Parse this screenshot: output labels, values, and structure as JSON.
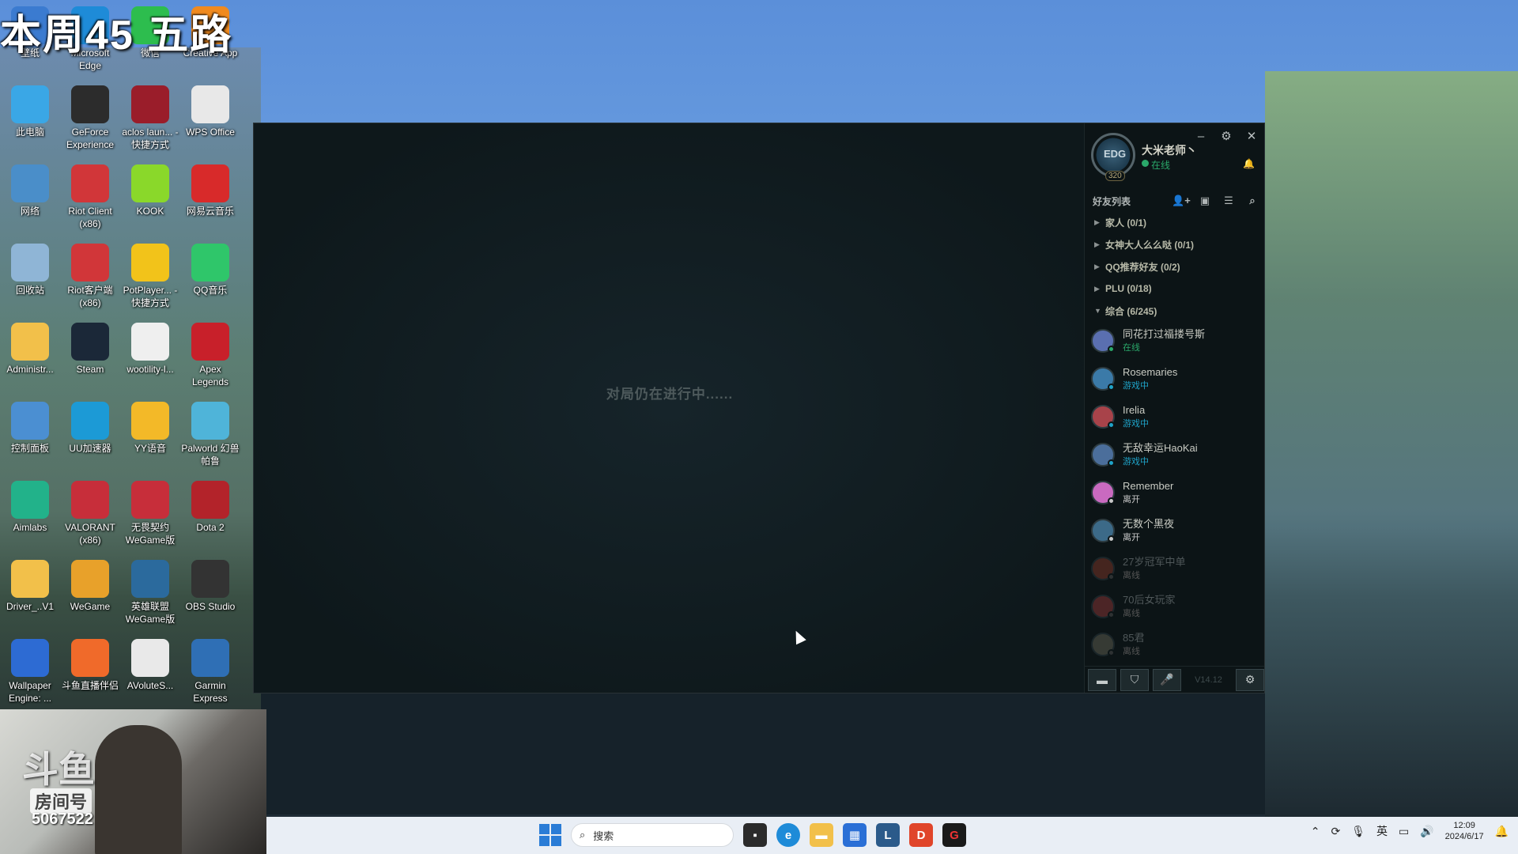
{
  "stream": {
    "title": "本周45 五路",
    "platform_logo": "斗鱼",
    "room_label": "房间号",
    "room_number": "5067522"
  },
  "desktop_icons": [
    {
      "label": "壁纸",
      "icon": "wallpaper-icon",
      "color": "#3b7bd0"
    },
    {
      "label": "Microsoft Edge",
      "icon": "edge-icon",
      "color": "#1e8bd8"
    },
    {
      "label": "微信",
      "icon": "wechat-icon",
      "color": "#2dbd4e"
    },
    {
      "label": "Creative App",
      "icon": "creative-app-icon",
      "color": "#f08a1e"
    },
    {
      "label": "此电脑",
      "icon": "this-pc-icon",
      "color": "#3aa7e6"
    },
    {
      "label": "GeForce Experience",
      "icon": "geforce-icon",
      "color": "#2c2c2c"
    },
    {
      "label": "aclos laun... - 快捷方式",
      "icon": "aclos-icon",
      "color": "#9a1d2a"
    },
    {
      "label": "WPS Office",
      "icon": "wps-icon",
      "color": "#e8e8e8"
    },
    {
      "label": "网络",
      "icon": "network-icon",
      "color": "#4a8ec9"
    },
    {
      "label": "Riot Client (x86)",
      "icon": "riot-client-icon",
      "color": "#d13639"
    },
    {
      "label": "KOOK",
      "icon": "kook-icon",
      "color": "#8ad82a"
    },
    {
      "label": "网易云音乐",
      "icon": "netease-music-icon",
      "color": "#d82a2a"
    },
    {
      "label": "回收站",
      "icon": "recycle-bin-icon",
      "color": "#8fb5d6"
    },
    {
      "label": "Riot客户端 (x86)",
      "icon": "riot-client-icon",
      "color": "#d13639"
    },
    {
      "label": "PotPlayer... - 快捷方式",
      "icon": "potplayer-icon",
      "color": "#f2c31a"
    },
    {
      "label": "QQ音乐",
      "icon": "qq-music-icon",
      "color": "#2fc66a"
    },
    {
      "label": "Administr...",
      "icon": "folder-icon",
      "color": "#f2c04a"
    },
    {
      "label": "Steam",
      "icon": "steam-icon",
      "color": "#1b2838"
    },
    {
      "label": "wootility-l...",
      "icon": "wootility-icon",
      "color": "#efefef"
    },
    {
      "label": "Apex Legends",
      "icon": "apex-icon",
      "color": "#c8202a"
    },
    {
      "label": "控制面板",
      "icon": "control-panel-icon",
      "color": "#4b8fd2"
    },
    {
      "label": "UU加速器",
      "icon": "uu-icon",
      "color": "#1c9ad6"
    },
    {
      "label": "YY语音",
      "icon": "yy-icon",
      "color": "#f3b928"
    },
    {
      "label": "Palworld 幻兽帕鲁",
      "icon": "palworld-icon",
      "color": "#4fb4d9"
    },
    {
      "label": "Aimlabs",
      "icon": "aimlabs-icon",
      "color": "#22b28a"
    },
    {
      "label": "VALORANT (x86)",
      "icon": "valorant-icon",
      "color": "#c72e3a"
    },
    {
      "label": "无畏契约 WeGame版",
      "icon": "valorant-wegame-icon",
      "color": "#c72e3a"
    },
    {
      "label": "Dota 2",
      "icon": "dota2-icon",
      "color": "#b3232a"
    },
    {
      "label": "Driver_..V1",
      "icon": "folder-icon",
      "color": "#f2c04a"
    },
    {
      "label": "WeGame",
      "icon": "wegame-icon",
      "color": "#e8a12a"
    },
    {
      "label": "英雄联盟 WeGame版",
      "icon": "lol-wegame-icon",
      "color": "#2b6a9d"
    },
    {
      "label": "OBS Studio",
      "icon": "obs-icon",
      "color": "#333333"
    },
    {
      "label": "Wallpaper Engine: ...",
      "icon": "wallpaper-engine-icon",
      "color": "#2d6bd3"
    },
    {
      "label": "斗鱼直播伴侣",
      "icon": "douyu-companion-icon",
      "color": "#f06a2a"
    },
    {
      "label": "AVoluteS...",
      "icon": "settings-file-icon",
      "color": "#e9e9e9"
    },
    {
      "label": "Garmin Express",
      "icon": "garmin-icon",
      "color": "#2f6fb5"
    }
  ],
  "client": {
    "game_status": "对局仍在进行中......",
    "profile": {
      "name": "大米老师丶",
      "status": "在线",
      "level": "320"
    },
    "friends_list_title": "好友列表",
    "groups": [
      {
        "label": "家人 (0/1)",
        "expanded": false
      },
      {
        "label": "女神大人么么哒 (0/1)",
        "expanded": false
      },
      {
        "label": "QQ推荐好友 (0/2)",
        "expanded": false
      },
      {
        "label": "PLU (0/18)",
        "expanded": false
      },
      {
        "label": "综合 (6/245)",
        "expanded": true
      }
    ],
    "friends": [
      {
        "name": "同花打过福搂号斯",
        "state": "在线",
        "state_color": "#2aa86a",
        "avatar_color": "#5a6fb0",
        "offline": false
      },
      {
        "name": "Rosemaries",
        "state": "游戏中",
        "state_color": "#1fa3c8",
        "avatar_color": "#3b7aa8",
        "offline": false
      },
      {
        "name": "Irelia",
        "state": "游戏中",
        "state_color": "#1fa3c8",
        "avatar_color": "#a8434a",
        "offline": false
      },
      {
        "name": "无敌幸运HaoKai",
        "state": "游戏中",
        "state_color": "#1fa3c8",
        "avatar_color": "#4b6e9b",
        "offline": false
      },
      {
        "name": "Remember",
        "state": "离开",
        "state_color": "#c8c8c8",
        "avatar_color": "#c96ac0",
        "offline": false
      },
      {
        "name": "无数个黑夜",
        "state": "离开",
        "state_color": "#c8c8c8",
        "avatar_color": "#3c6a88",
        "offline": false
      },
      {
        "name": "27岁冠军中单",
        "state": "离线",
        "state_color": "#555555",
        "avatar_color": "#8a3a2a",
        "offline": true
      },
      {
        "name": "70后女玩家",
        "state": "离线",
        "state_color": "#555555",
        "avatar_color": "#9a3a3a",
        "offline": true
      },
      {
        "name": "85君",
        "state": "离线",
        "state_color": "#555555",
        "avatar_color": "#6a6a5a",
        "offline": true
      }
    ],
    "version": "V14.12"
  },
  "taskbar": {
    "search_placeholder": "搜索",
    "input_method": "英",
    "time": "12:09",
    "date": "2024/6/17"
  }
}
